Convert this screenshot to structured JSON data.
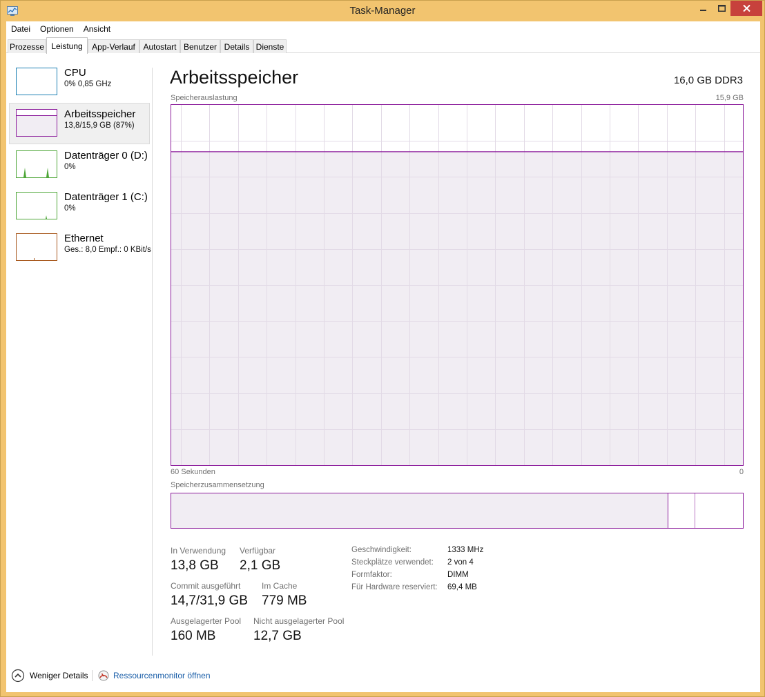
{
  "window": {
    "title": "Task-Manager"
  },
  "menu": {
    "items": [
      "Datei",
      "Optionen",
      "Ansicht"
    ]
  },
  "tabs": [
    "Prozesse",
    "Leistung",
    "App-Verlauf",
    "Autostart",
    "Benutzer",
    "Details",
    "Dienste"
  ],
  "sidebar": {
    "items": [
      {
        "label": "CPU",
        "sub": "0%  0,85 GHz",
        "color": "#1a7fb3"
      },
      {
        "label": "Arbeitsspeicher",
        "sub": "13,8/15,9 GB (87%)",
        "color": "#8b1b9b"
      },
      {
        "label": "Datenträger 0 (D:)",
        "sub": "0%",
        "color": "#4da637"
      },
      {
        "label": "Datenträger 1 (C:)",
        "sub": "0%",
        "color": "#4da637"
      },
      {
        "label": "Ethernet",
        "sub": "Ges.: 8,0  Empf.: 0 KBit/s",
        "color": "#a7581d"
      }
    ]
  },
  "main": {
    "title": "Arbeitsspeicher",
    "spec": "16,0 GB DDR3",
    "graph": {
      "label": "Speicherauslastung",
      "max_label": "15,9 GB",
      "x_left": "60 Sekunden",
      "x_right": "0",
      "usage_fraction": 0.87,
      "color": "#8b1b9b"
    },
    "composition": {
      "label": "Speicherzusammensetzung",
      "in_use_fraction": 0.87,
      "modified_fraction": 0.047
    },
    "stats": {
      "in_use_label": "In Verwendung",
      "in_use_value": "13,8 GB",
      "available_label": "Verfügbar",
      "available_value": "2,1 GB",
      "commit_label": "Commit ausgeführt",
      "commit_value": "14,7/31,9 GB",
      "cached_label": "Im Cache",
      "cached_value": "779 MB",
      "paged_label": "Ausgelagerter Pool",
      "paged_value": "160 MB",
      "nonpaged_label": "Nicht ausgelagerter Pool",
      "nonpaged_value": "12,7 GB"
    },
    "properties": [
      {
        "label": "Geschwindigkeit:",
        "value": "1333 MHz"
      },
      {
        "label": "Steckplätze verwendet:",
        "value": "2 von 4"
      },
      {
        "label": "Formfaktor:",
        "value": "DIMM"
      },
      {
        "label": "Für Hardware reserviert:",
        "value": "69,4 MB"
      }
    ]
  },
  "footer": {
    "fewer_details": "Weniger Details",
    "resource_monitor": "Ressourcenmonitor öffnen"
  }
}
